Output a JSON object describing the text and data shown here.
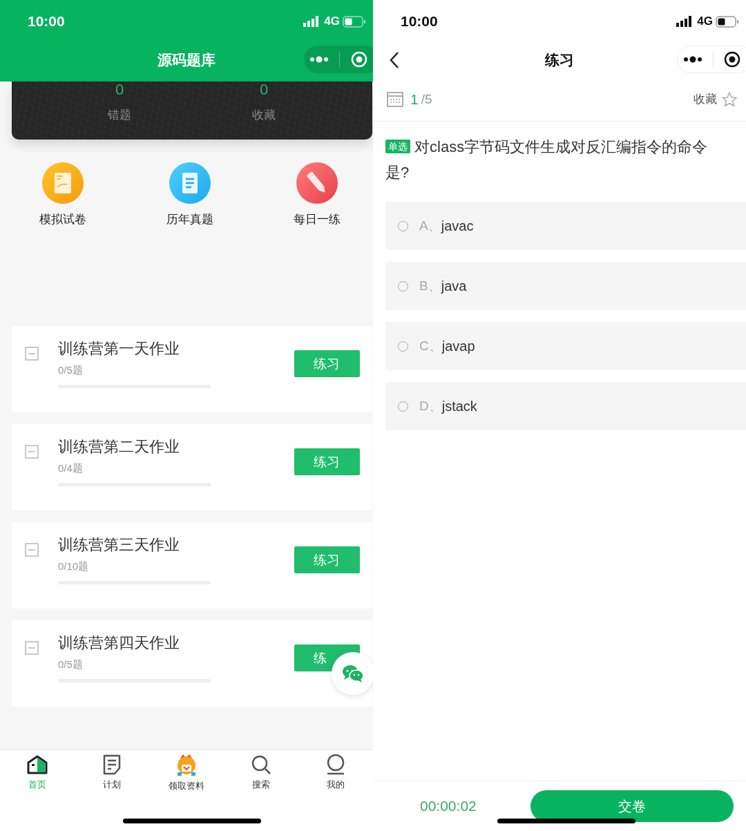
{
  "left": {
    "status_bar": {
      "time": "10:00",
      "network": "4G"
    },
    "title": "源码题库",
    "stats": [
      {
        "value": "0",
        "label": "错题"
      },
      {
        "value": "0",
        "label": "收藏"
      }
    ],
    "shortcuts": [
      {
        "kind": "exam",
        "label": "模拟试卷"
      },
      {
        "kind": "past",
        "label": "历年真题"
      },
      {
        "kind": "daily",
        "label": "每日一练"
      }
    ],
    "assignments": [
      {
        "title": "训练营第一天作业",
        "progress": "0/5题",
        "button": "练习"
      },
      {
        "title": "训练营第二天作业",
        "progress": "0/4题",
        "button": "练习"
      },
      {
        "title": "训练营第三天作业",
        "progress": "0/10题",
        "button": "练习"
      },
      {
        "title": "训练营第四天作业",
        "progress": "0/5题",
        "button": "练"
      }
    ],
    "tab_bar": [
      {
        "kind": "home",
        "label": "首页",
        "selected": true
      },
      {
        "kind": "plan",
        "label": "计划",
        "selected": false
      },
      {
        "kind": "gift",
        "label": "领取资料",
        "selected": false
      },
      {
        "kind": "search",
        "label": "搜索",
        "selected": false
      },
      {
        "kind": "profile",
        "label": "我的",
        "selected": false
      }
    ]
  },
  "right": {
    "status_bar": {
      "time": "10:00",
      "network": "4G"
    },
    "title": "练习",
    "counter": {
      "current": "1",
      "total": "/5"
    },
    "favorite": "收藏",
    "question": {
      "type": "单选",
      "text": "对class字节码文件生成对反汇编指令的命令是?"
    },
    "options": [
      {
        "letter": "A、",
        "text": "javac",
        "selected": false
      },
      {
        "letter": "B、",
        "text": "java",
        "selected": false
      },
      {
        "letter": "C、",
        "text": "javap",
        "selected": false
      },
      {
        "letter": "D、",
        "text": "jstack",
        "selected": false
      }
    ],
    "timer": "00:00:02",
    "submit": "交卷"
  }
}
